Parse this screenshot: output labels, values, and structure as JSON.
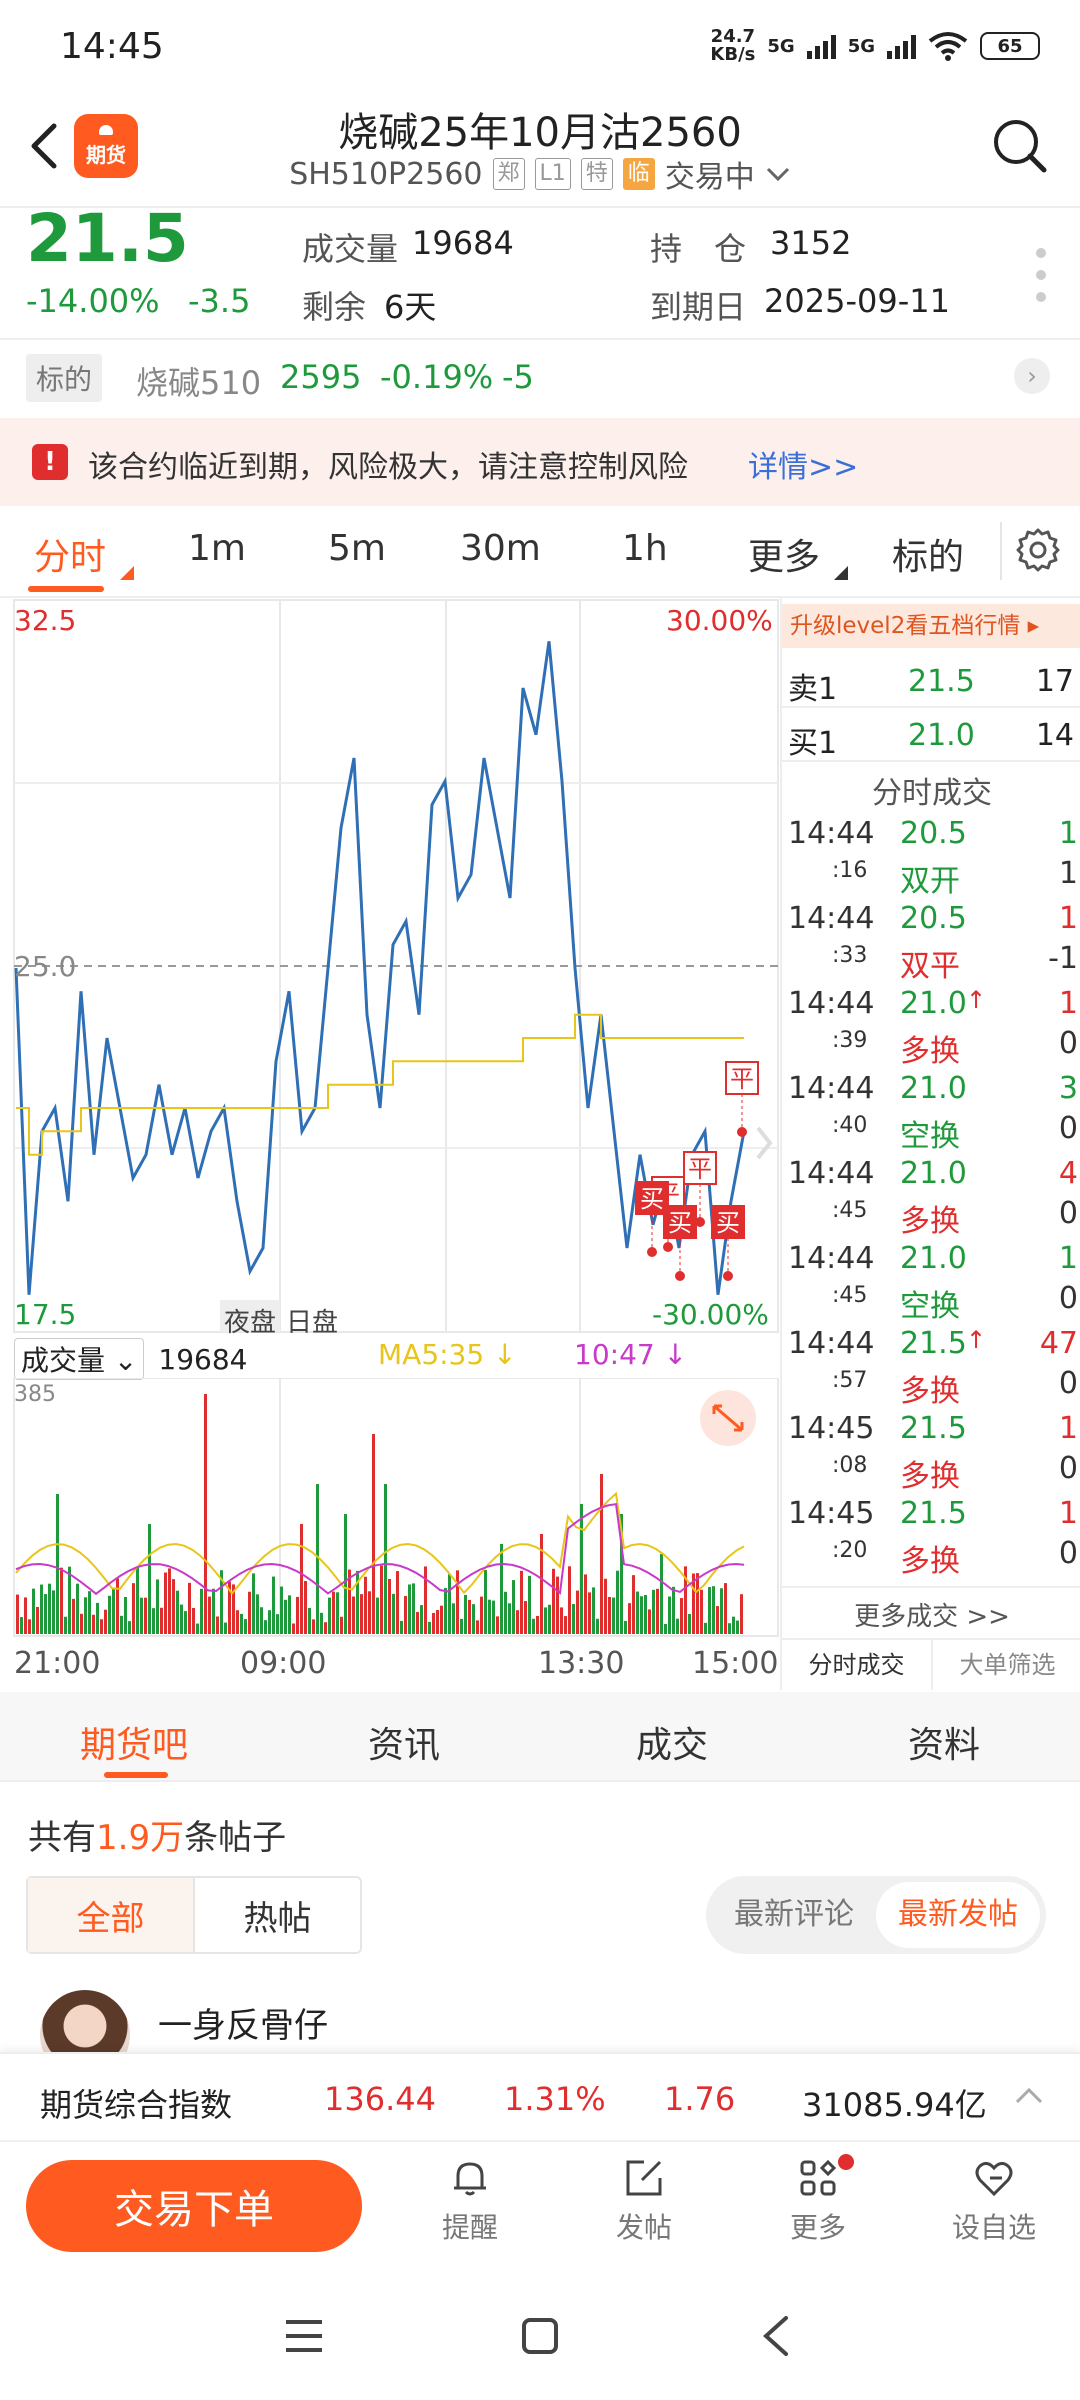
{
  "status_bar": {
    "time": "14:45",
    "net_speed_top": "24.7",
    "net_speed_bottom": "KB/s",
    "sig1": "5G",
    "sig2": "5G",
    "battery": "65"
  },
  "header": {
    "title": "烧碱25年10月沽2560",
    "code": "SH510P2560",
    "tags": [
      "郑",
      "L1",
      "特",
      "临"
    ],
    "status": "交易中",
    "logo_text": "期货"
  },
  "quote": {
    "price": "21.5",
    "change_pct": "-14.00%",
    "change": "-3.5",
    "volume_label": "成交量",
    "volume": "19684",
    "remaining_label": "剩余",
    "remaining": "6天",
    "position_label": "持　仓",
    "position": "3152",
    "expiry_label": "到期日",
    "expiry": "2025-09-11"
  },
  "underlying": {
    "tag": "标的",
    "name": "烧碱510",
    "price": "2595",
    "pct": "-0.19%",
    "change": "-5"
  },
  "warning": {
    "text": "该合约临近到期，风险极大，请注意控制风险",
    "link": "详情>>"
  },
  "period_tabs": [
    "分时",
    "1m",
    "5m",
    "30m",
    "1h",
    "更多",
    "标的"
  ],
  "chart": {
    "y_max": "32.5",
    "y_min": "17.5",
    "y_mid": "25.0",
    "pct_max": "30.00%",
    "pct_min": "-30.00%",
    "session_night": "夜盘",
    "session_day": "日盘",
    "volume_select": "成交量",
    "volume_value": "19684",
    "ma5": "MA5:35",
    "ma10": "10:47",
    "vol_max": "385",
    "time_labels": [
      "21:00",
      "09:00",
      "13:30",
      "15:00"
    ],
    "markers": [
      "平",
      "平",
      "平",
      "买",
      "买",
      "买"
    ]
  },
  "chart_data": {
    "type": "line",
    "title": "",
    "ylim": [
      17.5,
      32.5
    ],
    "x_ticks": [
      "21:00",
      "09:00",
      "13:30",
      "15:00"
    ],
    "series": [
      {
        "values": [
          25.0,
          18.0,
          21.5,
          22.0,
          20.0,
          24.5,
          21.0,
          23.5,
          22.0,
          20.5,
          21.0,
          22.5,
          21.0,
          22.0,
          20.5,
          21.5,
          22.0,
          20.0,
          18.5,
          19.0,
          23.0,
          24.5,
          21.5,
          22.0,
          25.0,
          28.0,
          29.5,
          24.0,
          22.0,
          25.5,
          26.0,
          24.0,
          28.5,
          29.0,
          26.5,
          27.0,
          29.5,
          28.0,
          26.5,
          31.0,
          30.0,
          32.0,
          29.0,
          25.0,
          22.0,
          24.0,
          21.5,
          19.0,
          21.0,
          19.5,
          20.5,
          19.0,
          21.0,
          21.5,
          18.0,
          20.0,
          21.5
        ]
      },
      {
        "values": [
          22.0,
          21.0,
          21.5,
          21.5,
          21.5,
          22.0,
          22.0,
          22.0,
          22.0,
          22.0,
          22.0,
          22.0,
          22.0,
          22.0,
          22.0,
          22.0,
          22.0,
          22.0,
          22.0,
          22.0,
          22.0,
          22.0,
          22.0,
          22.0,
          22.5,
          22.5,
          22.5,
          22.5,
          22.5,
          23.0,
          23.0,
          23.0,
          23.0,
          23.0,
          23.0,
          23.0,
          23.0,
          23.0,
          23.0,
          23.5,
          23.5,
          23.5,
          23.5,
          24.0,
          24.0,
          23.5,
          23.5,
          23.5,
          23.5,
          23.5,
          23.5,
          23.5,
          23.5,
          23.5,
          23.5,
          23.5,
          23.5
        ]
      }
    ]
  },
  "side_panel": {
    "banner": "升级level2看五档行情 ▸",
    "ask_label": "卖1",
    "ask_price": "21.5",
    "ask_vol": "17",
    "bid_label": "买1",
    "bid_price": "21.0",
    "bid_vol": "14",
    "heading": "分时成交",
    "trades": [
      {
        "time": "14:44",
        "sec": ":16",
        "price": "20.5",
        "arrow": "",
        "vol": "1",
        "type": "双开",
        "oi": "1",
        "price_color": "green",
        "vol_color": "green",
        "type_color": "green"
      },
      {
        "time": "14:44",
        "sec": ":33",
        "price": "20.5",
        "arrow": "",
        "vol": "1",
        "type": "双平",
        "oi": "-1",
        "price_color": "green",
        "vol_color": "red",
        "type_color": "red"
      },
      {
        "time": "14:44",
        "sec": ":39",
        "price": "21.0",
        "arrow": "↑",
        "vol": "1",
        "type": "多换",
        "oi": "0",
        "price_color": "green",
        "vol_color": "red",
        "type_color": "red"
      },
      {
        "time": "14:44",
        "sec": ":40",
        "price": "21.0",
        "arrow": "",
        "vol": "3",
        "type": "空换",
        "oi": "0",
        "price_color": "green",
        "vol_color": "green",
        "type_color": "green"
      },
      {
        "time": "14:44",
        "sec": ":45",
        "price": "21.0",
        "arrow": "",
        "vol": "4",
        "type": "多换",
        "oi": "0",
        "price_color": "green",
        "vol_color": "red",
        "type_color": "red"
      },
      {
        "time": "14:44",
        "sec": ":45",
        "price": "21.0",
        "arrow": "",
        "vol": "1",
        "type": "空换",
        "oi": "0",
        "price_color": "green",
        "vol_color": "green",
        "type_color": "green"
      },
      {
        "time": "14:44",
        "sec": ":57",
        "price": "21.5",
        "arrow": "↑",
        "vol": "47",
        "type": "多换",
        "oi": "0",
        "price_color": "green",
        "vol_color": "red",
        "type_color": "red"
      },
      {
        "time": "14:45",
        "sec": ":08",
        "price": "21.5",
        "arrow": "",
        "vol": "1",
        "type": "多换",
        "oi": "0",
        "price_color": "green",
        "vol_color": "red",
        "type_color": "red"
      },
      {
        "time": "14:45",
        "sec": ":20",
        "price": "21.5",
        "arrow": "",
        "vol": "1",
        "type": "多换",
        "oi": "0",
        "price_color": "green",
        "vol_color": "red",
        "type_color": "red"
      }
    ],
    "more": "更多成交 >>",
    "tab1": "分时成交",
    "tab2": "大单筛选"
  },
  "community_tabs": [
    "期货吧",
    "资讯",
    "成交",
    "资料"
  ],
  "posts": {
    "count_prefix": "共有",
    "count": "1.9万",
    "count_suffix": "条帖子",
    "filter_all": "全部",
    "filter_hot": "热帖",
    "sort_comment": "最新评论",
    "sort_post": "最新发帖",
    "first_user": "一身反骨仔"
  },
  "index_bar": {
    "name": "期货综合指数",
    "value": "136.44",
    "pct": "1.31%",
    "change": "1.76",
    "amount": "31085.94亿"
  },
  "toolbar": {
    "trade": "交易下单",
    "remind": "提醒",
    "post": "发帖",
    "more": "更多",
    "watch": "设自选"
  },
  "colors": {
    "accent": "#ff5a1f",
    "up": "#e02d2d",
    "down": "#1e9a3c",
    "price_line": "#2f6fb5",
    "avg_line": "#e8c51a"
  }
}
